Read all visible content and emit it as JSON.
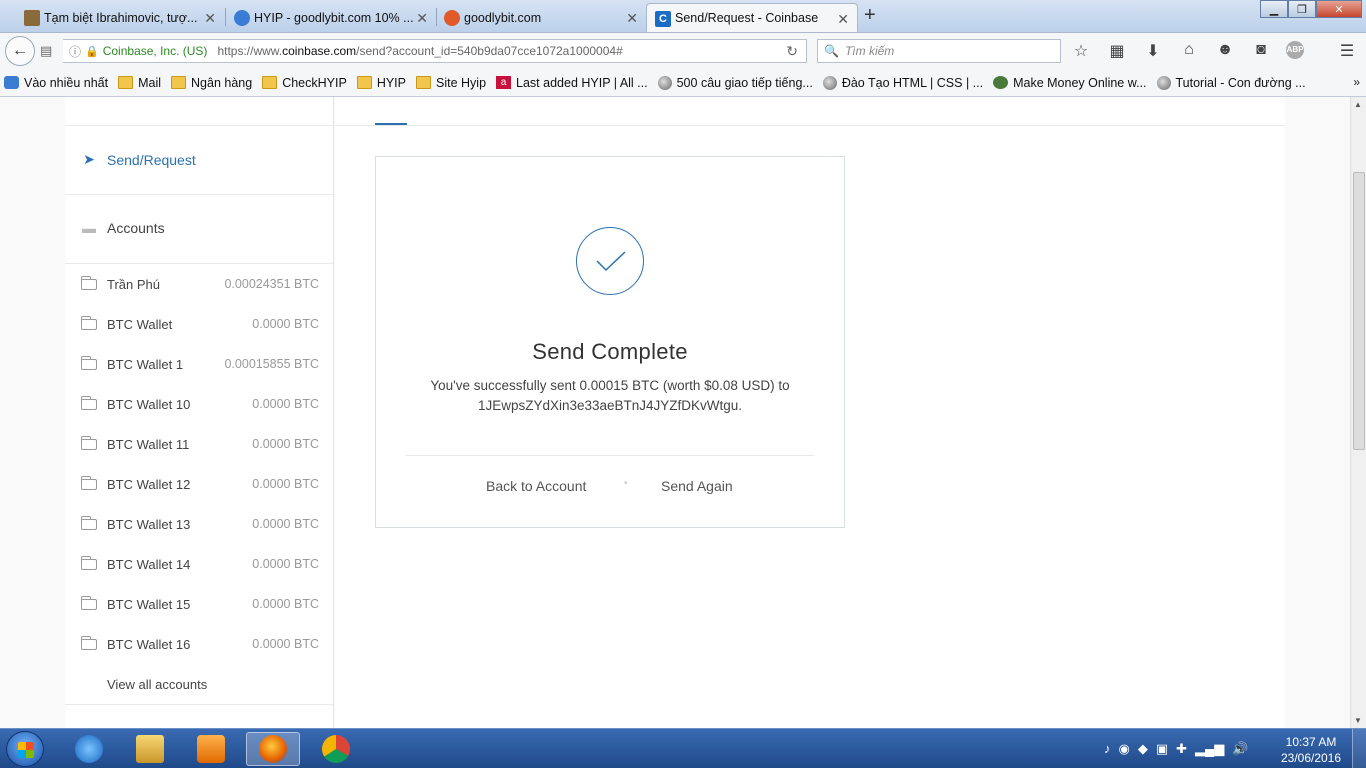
{
  "browser": {
    "tabs": [
      {
        "title": "Tạm biệt Ibrahimovic, tượ...",
        "icon": "news-icon",
        "icon_color": "#8a6a3a"
      },
      {
        "title": "HYIP - goodlybit.com 10% ...",
        "icon": "hyip-icon",
        "icon_color": "#3a7bd5"
      },
      {
        "title": "goodlybit.com",
        "icon": "goodlybit-icon",
        "icon_color": "#e05a2a"
      },
      {
        "title": "Send/Request - Coinbase",
        "icon": "coinbase-icon",
        "icon_color": "#1a6cc4",
        "icon_letter": "C"
      }
    ],
    "new_tab": "+",
    "url_site": "Coinbase, Inc. (US)",
    "url_prefix": "https://www.",
    "url_domain": "coinbase.com",
    "url_path": "/send?account_id=540b9da07cce1072a1000004#",
    "search_placeholder": "Tìm kiếm",
    "abp_label": "ABP",
    "bookmarks": [
      {
        "label": "Vào nhiều nhất",
        "icon": "firefox-icon"
      },
      {
        "label": "Mail",
        "icon": "folder-icon"
      },
      {
        "label": "Ngân hàng",
        "icon": "folder-icon"
      },
      {
        "label": "CheckHYIP",
        "icon": "folder-icon"
      },
      {
        "label": "HYIP",
        "icon": "folder-icon"
      },
      {
        "label": "Site Hyip",
        "icon": "folder-icon"
      },
      {
        "label": "Last added HYIP | All ...",
        "icon": "allhyip-icon",
        "icon_letter": "a"
      },
      {
        "label": "500 câu giao tiếp tiếng...",
        "icon": "globe-icon"
      },
      {
        "label": "Đào Tạo HTML | CSS | ...",
        "icon": "globe-icon"
      },
      {
        "label": "Make Money Online w...",
        "icon": "moneytree-icon"
      },
      {
        "label": "Tutorial - Con đường ...",
        "icon": "globe-icon"
      }
    ],
    "bookmarks_more": "»"
  },
  "sidebar": {
    "send_request": "Send/Request",
    "accounts_label": "Accounts",
    "accounts": [
      {
        "name": "Trần Phú",
        "balance": "0.00024351 BTC"
      },
      {
        "name": "BTC Wallet",
        "balance": "0.0000 BTC"
      },
      {
        "name": "BTC Wallet 1",
        "balance": "0.00015855 BTC"
      },
      {
        "name": "BTC Wallet 10",
        "balance": "0.0000 BTC"
      },
      {
        "name": "BTC Wallet 11",
        "balance": "0.0000 BTC"
      },
      {
        "name": "BTC Wallet 12",
        "balance": "0.0000 BTC"
      },
      {
        "name": "BTC Wallet 13",
        "balance": "0.0000 BTC"
      },
      {
        "name": "BTC Wallet 14",
        "balance": "0.0000 BTC"
      },
      {
        "name": "BTC Wallet 15",
        "balance": "0.0000 BTC"
      },
      {
        "name": "BTC Wallet 16",
        "balance": "0.0000 BTC"
      }
    ],
    "view_all": "View all accounts"
  },
  "main": {
    "title": "Send Complete",
    "message_line1": "You've successfully sent 0.00015 BTC (worth $0.08 USD) to",
    "message_line2": "1JEwpsZYdXin3e33aeBTnJ4JYZfDKvWtgu.",
    "back_to_account": "Back to Account",
    "send_again": "Send Again",
    "accent_color": "#2b71b1"
  },
  "taskbar": {
    "time": "10:37 AM",
    "date": "23/06/2016"
  }
}
